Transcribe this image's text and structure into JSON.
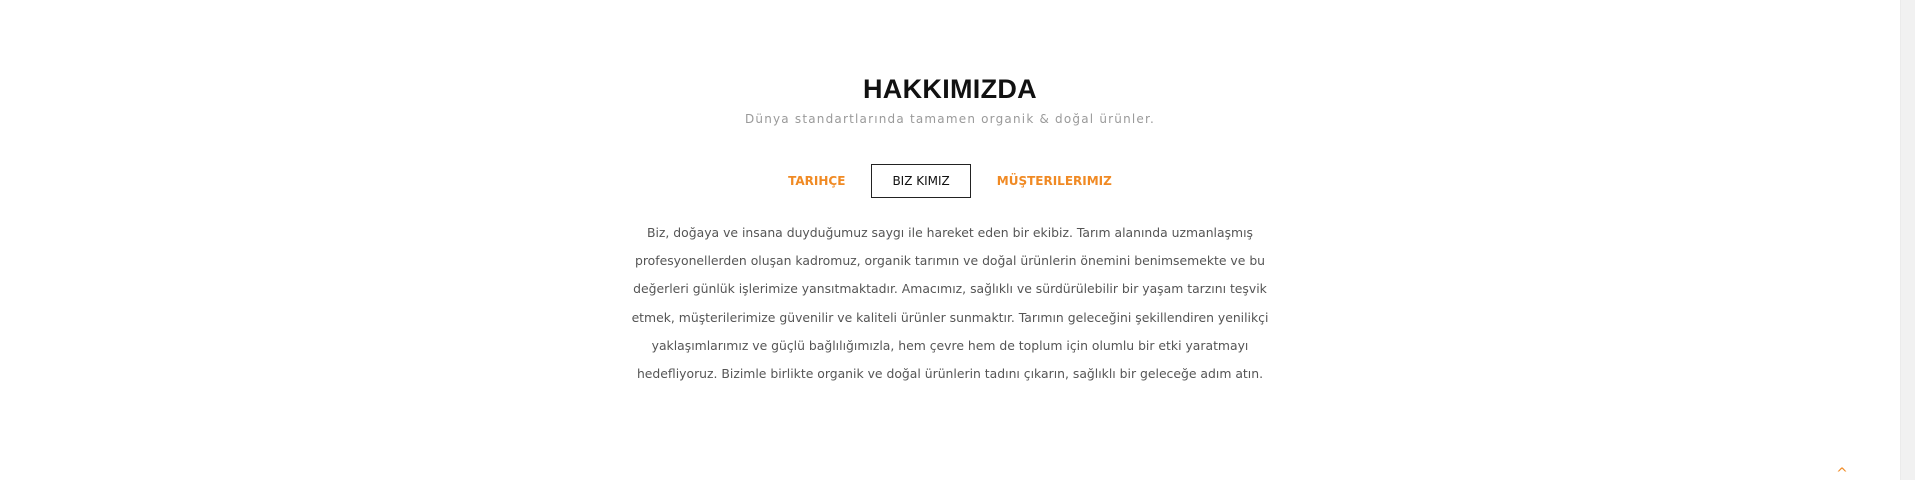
{
  "about": {
    "title": "HAKKIMIZDA",
    "subtitle": "Dünya standartlarında tamamen organik & doğal ürünler.",
    "tabs": [
      {
        "label": "TARIHÇE",
        "active": false
      },
      {
        "label": "BIZ KIMIZ",
        "active": true
      },
      {
        "label": "MÜŞTERILERIMIZ",
        "active": false
      }
    ],
    "body": "Biz, doğaya ve insana duyduğumuz saygı ile hareket eden bir ekibiz. Tarım alanında uzmanlaşmış profesyonellerden oluşan kadromuz, organik tarımın ve doğal ürünlerin önemini benimsemekte ve bu değerleri günlük işlerimize yansıtmaktadır. Amacımız, sağlıklı ve sürdürülebilir bir yaşam tarzını teşvik etmek, müşterilerimize güvenilir ve kaliteli ürünler sunmaktır. Tarımın geleceğini şekillendiren yenilikçi yaklaşımlarımız ve güçlü bağlılığımızla, hem çevre hem de toplum için olumlu bir etki yaratmayı hedefliyoruz. Bizimle birlikte organik ve doğal ürünlerin tadını çıkarın, sağlıklı bir geleceğe adım atın."
  },
  "back_to_top": {
    "icon": "chevron-up-icon",
    "glyph": "^"
  },
  "colors": {
    "accent": "#f08a24",
    "text": "#555555",
    "title": "#111111"
  }
}
